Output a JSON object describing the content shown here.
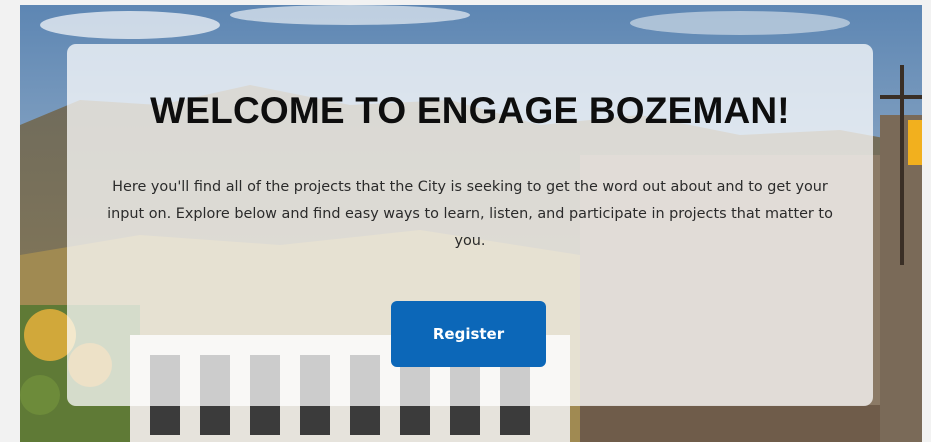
{
  "hero": {
    "title": "WELCOME TO ENGAGE BOZEMAN!",
    "body": "Here you'll find all of the projects that the City is seeking to get the word out about and to get your input on. Explore below and find easy ways to learn, listen, and participate in projects that matter to you.",
    "register_label": "Register"
  },
  "colors": {
    "button": "#0c67b8",
    "button_text": "#ffffff",
    "title_text": "#0e0e0e"
  }
}
